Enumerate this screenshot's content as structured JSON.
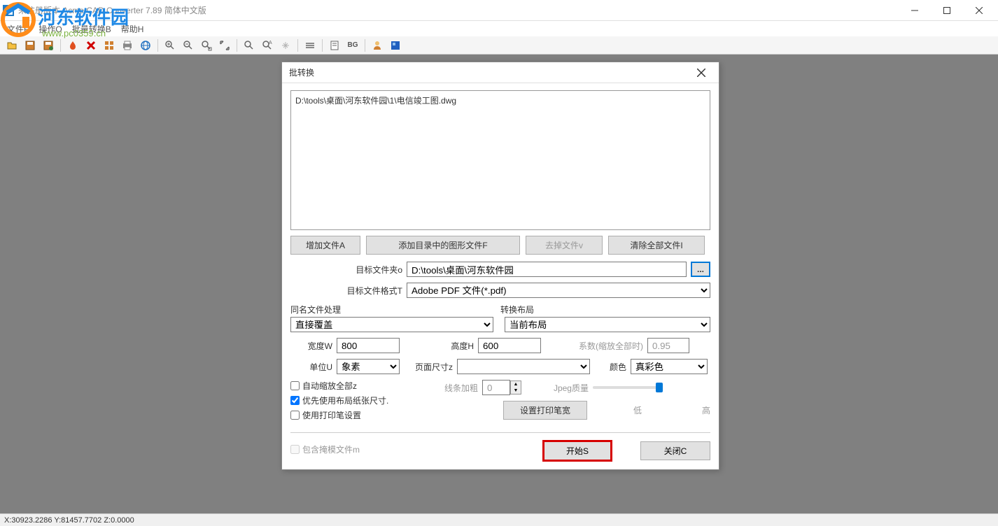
{
  "app": {
    "title": "未注册版本 Acme CAD Converter 7.89 简体中文版"
  },
  "menu": {
    "file": "文件F",
    "operate": "操作O",
    "batch": "批量转换B",
    "help": "帮助H"
  },
  "watermark": {
    "brand": "河东软件园",
    "url": "www.pc0359.cn"
  },
  "dialog": {
    "title": "批转换",
    "filelist": [
      "D:\\tools\\桌面\\河东软件园\\1\\电信竣工图.dwg"
    ],
    "btns": {
      "add_file": "增加文件A",
      "add_folder": "添加目录中的图形文件F",
      "remove": "去掉文件v",
      "clear": "清除全部文件I"
    },
    "target_folder_label": "目标文件夹o",
    "target_folder": "D:\\tools\\桌面\\河东软件园",
    "target_format_label": "目标文件格式T",
    "target_format": "Adobe PDF 文件(*.pdf)",
    "browse": "...",
    "dup_label": "同名文件处理",
    "dup_value": "直接覆盖",
    "layout_label": "转换布局",
    "layout_value": "当前布局",
    "width_label": "宽度W",
    "width_value": "800",
    "height_label": "高度H",
    "height_value": "600",
    "scale_label": "系数(缩放全部时)",
    "scale_value": "0.95",
    "unit_label": "单位U",
    "unit_value": "象素",
    "pagesize_label": "页面尺寸z",
    "pagesize_value": "",
    "color_label": "颜色",
    "color_value": "真彩色",
    "autoscale_label": "自动缩放全部z",
    "uselayout_label": "优先使用布局纸张尺寸.",
    "usepen_label": "使用打印笔设置",
    "lineweight_label": "线条加粗",
    "lineweight_value": "0",
    "penwidth_btn": "设置打印笔宽",
    "jpeg_label": "Jpeg质量",
    "jpeg_low": "低",
    "jpeg_high": "高",
    "include_mask_label": "包含掩模文件m",
    "start_btn": "开始S",
    "close_btn": "关闭C"
  },
  "status": {
    "coords": "X:30923.2286 Y:81457.7702 Z:0.0000"
  }
}
